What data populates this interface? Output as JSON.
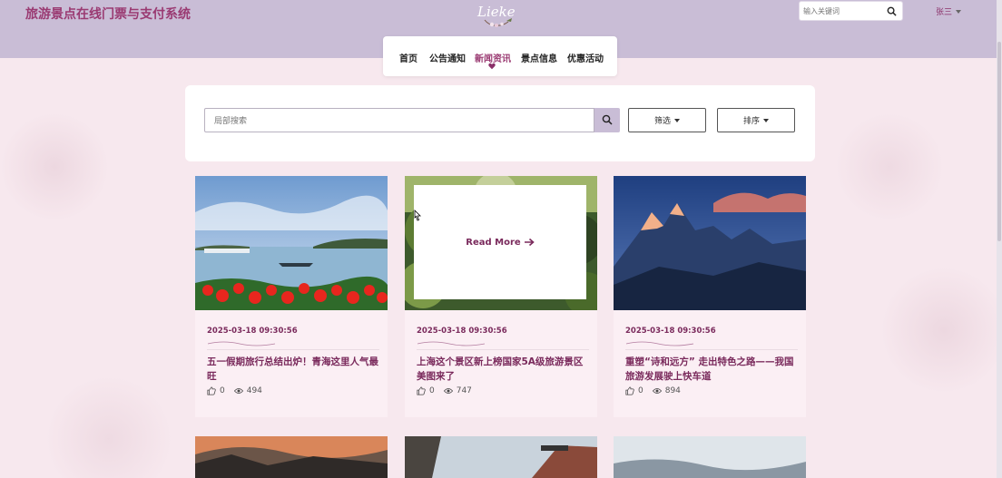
{
  "header": {
    "site_title": "旅游景点在线门票与支付系统",
    "logo_text": "Lieke",
    "search_placeholder": "输入关键词",
    "user_name": "张三"
  },
  "nav": {
    "items": [
      {
        "label": "首页",
        "active": false
      },
      {
        "label": "公告通知",
        "active": false
      },
      {
        "label": "新闻资讯",
        "active": true
      },
      {
        "label": "景点信息",
        "active": false
      },
      {
        "label": "优惠活动",
        "active": false
      }
    ]
  },
  "filters": {
    "search_placeholder": "局部搜索",
    "filter_label": "筛选",
    "sort_label": "排序"
  },
  "cards": [
    {
      "date": "2025-03-18 09:30:56",
      "title": "五一假期旅行总结出炉！青海这里人气最旺",
      "likes": "0",
      "views": "494"
    },
    {
      "date": "2025-03-18 09:30:56",
      "title": "上海这个景区新上榜国家5A级旅游景区 美图来了",
      "likes": "0",
      "views": "747",
      "overlay_label": "Read More"
    },
    {
      "date": "2025-03-18 09:30:56",
      "title": "重塑“诗和远方” 走出特色之路——我国旅游发展驶上快车道",
      "likes": "0",
      "views": "894"
    }
  ],
  "colors": {
    "accent": "#9a3a72",
    "header_bg": "#c9bdd6",
    "page_bg": "#f7e8ee"
  }
}
